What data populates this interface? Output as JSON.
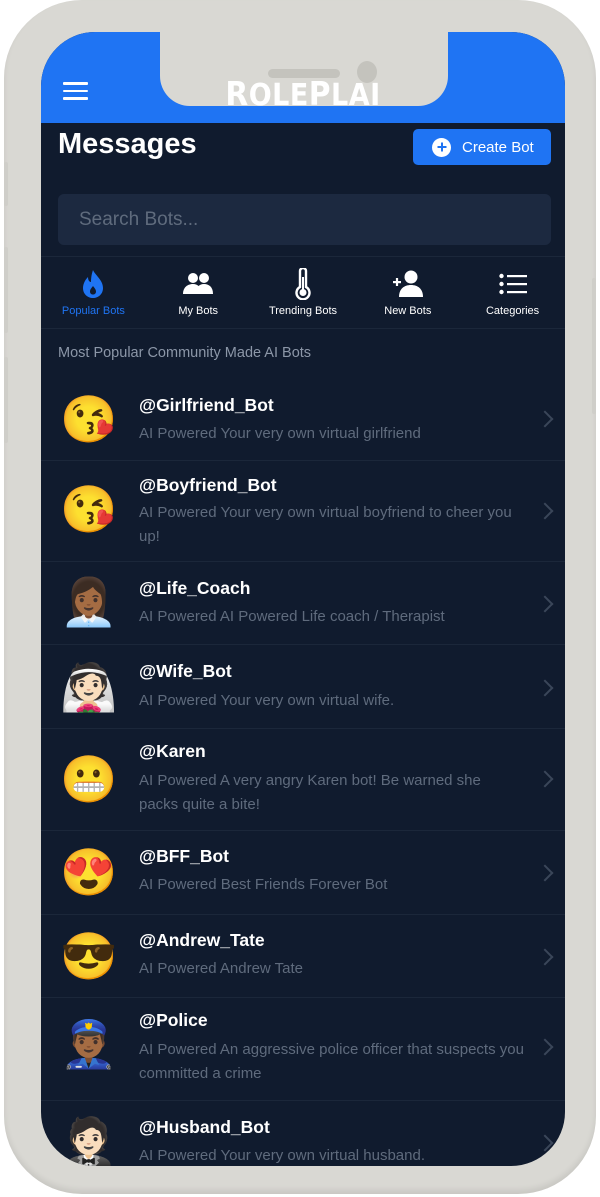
{
  "header": {
    "menu_icon": "hamburger-menu-icon",
    "logo_first": "R",
    "logo_part1": "OLE",
    "logo_second": "P",
    "logo_part2": "LAI",
    "brand_color": "#1f74f3"
  },
  "page": {
    "title": "Messages",
    "create_label": "Create Bot",
    "create_icon": "plus-circle-icon"
  },
  "search": {
    "placeholder": "Search Bots...",
    "value": ""
  },
  "tabs": [
    {
      "label": "Popular Bots",
      "icon": "flame-icon",
      "active": true
    },
    {
      "label": "My Bots",
      "icon": "users-icon",
      "active": false
    },
    {
      "label": "Trending Bots",
      "icon": "thermometer-icon",
      "active": false
    },
    {
      "label": "New Bots",
      "icon": "user-plus-icon",
      "active": false
    },
    {
      "label": "Categories",
      "icon": "list-icon",
      "active": false
    }
  ],
  "section_title": "Most Popular Community Made AI Bots",
  "bots": [
    {
      "name": "@Girlfriend_Bot",
      "desc": "AI Powered Your very own virtual girlfriend",
      "avatar": "😘"
    },
    {
      "name": "@Boyfriend_Bot",
      "desc": "AI Powered Your very own virtual boyfriend to cheer you up!",
      "avatar": "😘"
    },
    {
      "name": "@Life_Coach",
      "desc": "AI Powered AI Powered Life coach / Therapist",
      "avatar": "👩🏾‍💼"
    },
    {
      "name": "@Wife_Bot",
      "desc": "AI Powered Your very own virtual wife.",
      "avatar": "👰🏻"
    },
    {
      "name": "@Karen",
      "desc": "AI Powered A very angry Karen bot! Be warned she packs quite a bite!",
      "avatar": "😬"
    },
    {
      "name": "@BFF_Bot",
      "desc": "AI Powered Best Friends Forever Bot",
      "avatar": "😍"
    },
    {
      "name": "@Andrew_Tate",
      "desc": "AI Powered Andrew Tate",
      "avatar": "😎"
    },
    {
      "name": "@Police",
      "desc": "AI Powered An aggressive police officer that suspects you committed a crime",
      "avatar": "👮🏾‍♂️"
    },
    {
      "name": "@Husband_Bot",
      "desc": "AI Powered Your very own virtual husband.",
      "avatar": "🤵🏻"
    }
  ]
}
